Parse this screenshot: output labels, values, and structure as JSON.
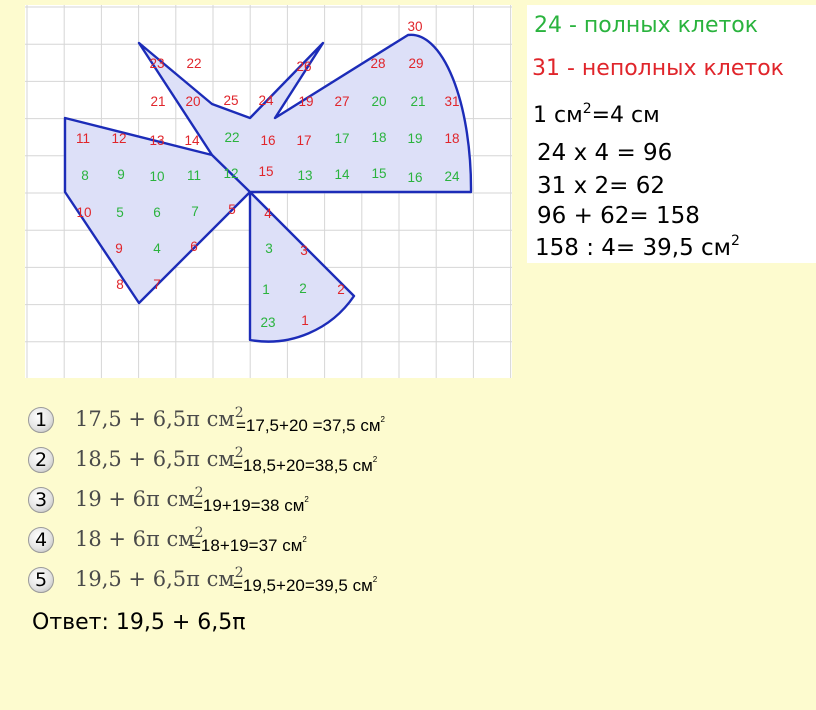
{
  "figure": {
    "colors": {
      "grid": "#d6d6d6",
      "fill": "#dde0f8",
      "outline": "#1c2cb8",
      "full_cell": "#2ab33e",
      "partial_cell": "#e0252b"
    },
    "cell_numbers": [
      [
        "30",
        "r"
      ],
      [
        "23",
        "r"
      ],
      [
        "22",
        "r"
      ],
      [
        "26",
        "r"
      ],
      [
        "28",
        "r"
      ],
      [
        "29",
        "r"
      ],
      [
        "21",
        "r"
      ],
      [
        "20",
        "r"
      ],
      [
        "25",
        "r"
      ],
      [
        "24",
        "r"
      ],
      [
        "19",
        "r"
      ],
      [
        "27",
        "r"
      ],
      [
        "20",
        "g"
      ],
      [
        "21",
        "g"
      ],
      [
        "31",
        "r"
      ],
      [
        "11",
        "r"
      ],
      [
        "12",
        "r"
      ],
      [
        "13",
        "r"
      ],
      [
        "14",
        "r"
      ],
      [
        "22",
        "g"
      ],
      [
        "16",
        "r"
      ],
      [
        "17",
        "r"
      ],
      [
        "17",
        "g"
      ],
      [
        "18",
        "g"
      ],
      [
        "19",
        "g"
      ],
      [
        "18",
        "r"
      ],
      [
        "8",
        "g"
      ],
      [
        "9",
        "g"
      ],
      [
        "10",
        "g"
      ],
      [
        "11",
        "g"
      ],
      [
        "12",
        "g"
      ],
      [
        "15",
        "r"
      ],
      [
        "13",
        "g"
      ],
      [
        "14",
        "g"
      ],
      [
        "15",
        "g"
      ],
      [
        "16",
        "g"
      ],
      [
        "24",
        "g"
      ],
      [
        "10",
        "r"
      ],
      [
        "5",
        "g"
      ],
      [
        "6",
        "g"
      ],
      [
        "7",
        "g"
      ],
      [
        "5",
        "r"
      ],
      [
        "4",
        "r"
      ],
      [
        "9",
        "r"
      ],
      [
        "4",
        "g"
      ],
      [
        "6",
        "r"
      ],
      [
        "3",
        "g"
      ],
      [
        "3",
        "r"
      ],
      [
        "8",
        "r"
      ],
      [
        "7",
        "r"
      ],
      [
        "1",
        "g"
      ],
      [
        "2",
        "g"
      ],
      [
        "2",
        "r"
      ],
      [
        "23",
        "g"
      ],
      [
        "1",
        "r"
      ]
    ]
  },
  "calc": {
    "full_cells": "24 - полных клеток",
    "partial_cells": "31 - неполных клеток",
    "unit_base": "1 см",
    "unit_exp": "2",
    "unit_rest": "=4 см",
    "line1": "24 x 4 = 96",
    "line2": "31 x 2= 62",
    "line3": "96 + 62= 158",
    "line4_base": "158 : 4= 39,5 см",
    "line4_exp": "2"
  },
  "options": [
    {
      "num": "1",
      "formula": "17,5 + 6,5π см",
      "exp": "2",
      "result": "=17,5+20 =37,5 см",
      "result_exp": "2"
    },
    {
      "num": "2",
      "formula": "18,5 + 6,5π см",
      "exp": "2",
      "result": "=18,5+20=38,5 см",
      "result_exp": "2"
    },
    {
      "num": "3",
      "formula": "19 + 6π см",
      "exp": "2",
      "result": "=19+19=38 см",
      "result_exp": "2"
    },
    {
      "num": "4",
      "formula": "18 + 6π см",
      "exp": "2",
      "result": "=18+19=37 см",
      "result_exp": "2"
    },
    {
      "num": "5",
      "formula": "19,5 + 6,5π см",
      "exp": "2",
      "result": "=19,5+20=39,5 см",
      "result_exp": "2"
    }
  ],
  "answer": "Ответ: 19,5 + 6,5π"
}
